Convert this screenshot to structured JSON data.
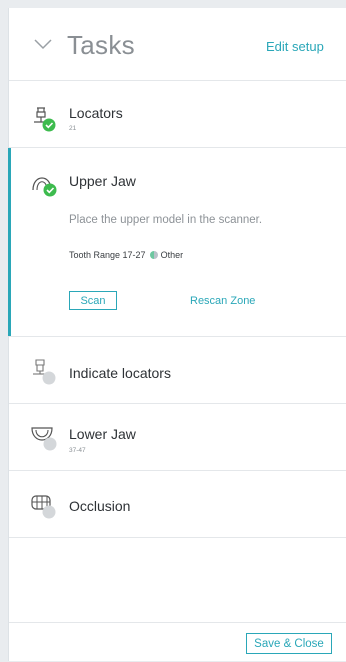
{
  "header": {
    "title": "Tasks",
    "edit_label": "Edit setup"
  },
  "tasks": [
    {
      "name": "Locators",
      "sub": "21",
      "status": "done"
    },
    {
      "name": "Upper Jaw",
      "status": "done",
      "instruction": "Place the upper model in the scanner.",
      "range_label": "Tooth Range 17-27",
      "range_tag": "Other",
      "scan_label": "Scan",
      "rescan_label": "Rescan Zone"
    },
    {
      "name": "Indicate locators",
      "status": "pending"
    },
    {
      "name": "Lower Jaw",
      "sub": "37-47",
      "status": "pending"
    },
    {
      "name": "Occlusion",
      "status": "pending"
    }
  ],
  "footer": {
    "save_label": "Save & Close"
  },
  "colors": {
    "accent": "#2aa7b8",
    "done": "#3dbb4e",
    "pending": "#d4d7da"
  }
}
